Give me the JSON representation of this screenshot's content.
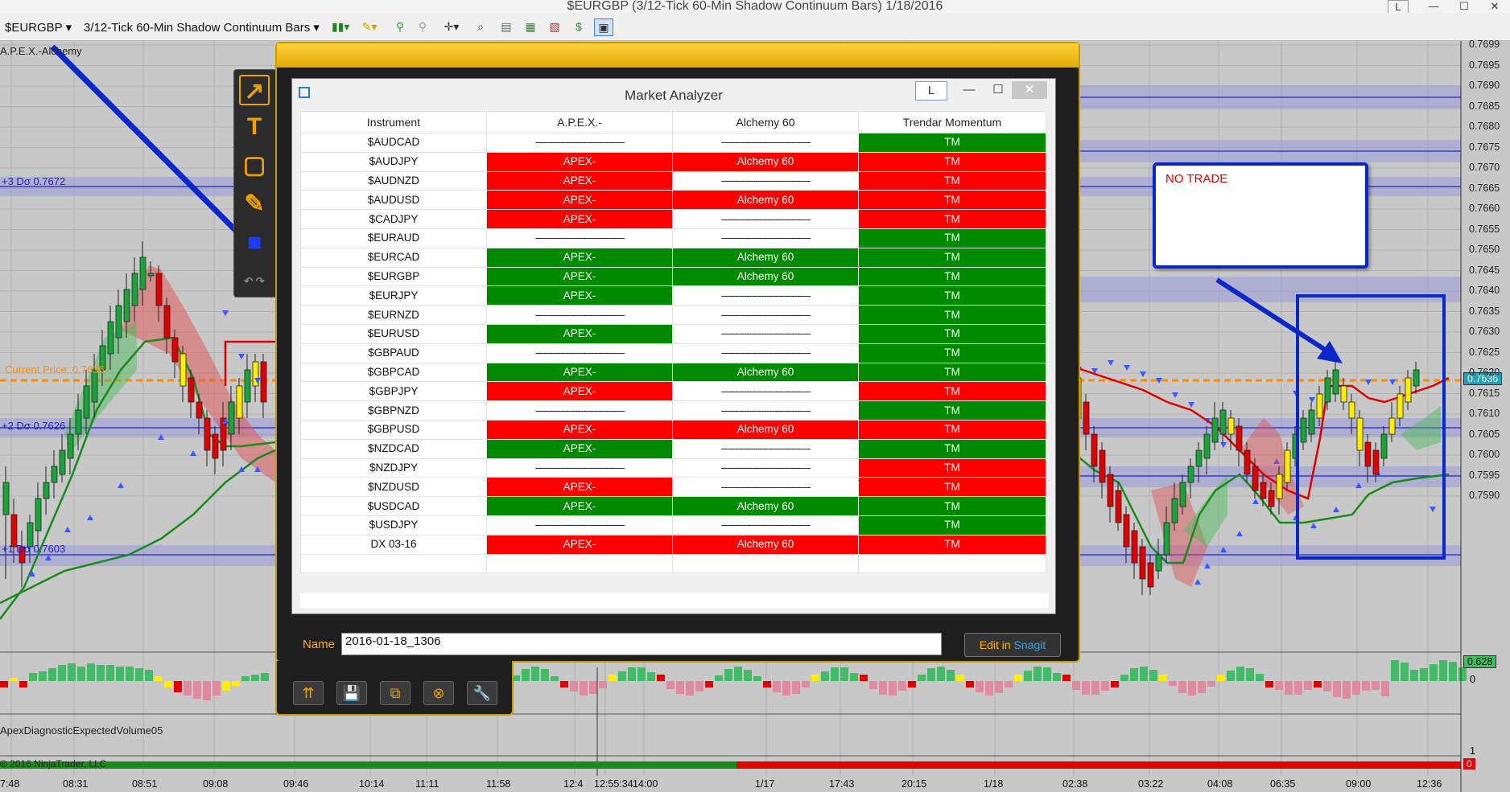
{
  "window_title": "$EURGBP (3/12-Tick 60-Min Shadow Continuum Bars)  1/18/2016",
  "window_controls": {
    "left_btn": "L",
    "minimize": "—",
    "maximize": "☐",
    "close": "✕"
  },
  "toolbar": {
    "instrument": "$EURGBP",
    "bars": "3/12-Tick 60-Min Shadow Continuum Bars"
  },
  "chart": {
    "indicator_label": "A.P.E.X.-Alchemy",
    "plus3_label": "+3 Dσ 0.7672",
    "plus2_label": "+2 Dσ 0.7626",
    "plus1_label": "+1 Dσ 0.7603",
    "current_price_label": "Current Price: 0.7636",
    "current_price_box": "0.7636",
    "volume_label": "ApexDiagnosticExpectedVolume05",
    "copyright": "© 2016 NinjaTrader, LLC",
    "osc_value": "0.628",
    "osc_zero": "0",
    "vol_zero": "0",
    "vol_one": "1",
    "price_axis": [
      "0.7699",
      "0.7695",
      "0.7690",
      "0.7685",
      "0.7680",
      "0.7675",
      "0.7670",
      "0.7665",
      "0.7660",
      "0.7655",
      "0.7650",
      "0.7645",
      "0.7640",
      "0.7635",
      "0.7630",
      "0.7625",
      "0.7620",
      "0.7615",
      "0.7610",
      "0.7605",
      "0.7600",
      "0.7595",
      "0.7590"
    ],
    "time_axis": [
      "7:48",
      "08:31",
      "08:51",
      "09:08",
      "09:46",
      "10:14",
      "11:11",
      "11:58",
      "12:4",
      "12:55:34",
      "14:00",
      "1/17",
      "17:43",
      "20:15",
      "1/18",
      "02:38",
      "03:22",
      "04:08",
      "06:35",
      "09:00",
      "12:36"
    ],
    "colors": {
      "bull": "#1aa33a",
      "bear": "#e00000",
      "neutral": "#ffee00",
      "band": "#3030d0",
      "annot": "#0a28c8",
      "current_price": "#ff8c00"
    }
  },
  "no_trade_label": "NO TRADE",
  "market_analyzer": {
    "title": "Market Analyzer",
    "controls": {
      "left": "L",
      "min": "—",
      "max": "☐",
      "close": "✕"
    },
    "columns": [
      "Instrument",
      "A.P.E.X.-",
      "Alchemy 60",
      "Trendar Momentum"
    ],
    "blank": "----------------------------—",
    "rows": [
      {
        "instrument": "$AUDCAD",
        "apex": "",
        "alchemy": "",
        "tm": "TM",
        "tm_color": "green"
      },
      {
        "instrument": "$AUDJPY",
        "apex": "APEX-",
        "apex_color": "red",
        "alchemy": "Alchemy 60",
        "alchemy_color": "red",
        "tm": "TM",
        "tm_color": "red"
      },
      {
        "instrument": "$AUDNZD",
        "apex": "APEX-",
        "apex_color": "red",
        "alchemy": "",
        "tm": "TM",
        "tm_color": "red"
      },
      {
        "instrument": "$AUDUSD",
        "apex": "APEX-",
        "apex_color": "red",
        "alchemy": "Alchemy 60",
        "alchemy_color": "red",
        "tm": "TM",
        "tm_color": "red"
      },
      {
        "instrument": "$CADJPY",
        "apex": "APEX-",
        "apex_color": "red",
        "alchemy": "",
        "tm": "TM",
        "tm_color": "red"
      },
      {
        "instrument": "$EURAUD",
        "apex": "",
        "alchemy": "",
        "tm": "TM",
        "tm_color": "green"
      },
      {
        "instrument": "$EURCAD",
        "apex": "APEX-",
        "apex_color": "green",
        "alchemy": "Alchemy 60",
        "alchemy_color": "green",
        "tm": "TM",
        "tm_color": "green"
      },
      {
        "instrument": "$EURGBP",
        "apex": "APEX-",
        "apex_color": "green",
        "alchemy": "Alchemy 60",
        "alchemy_color": "green",
        "tm": "TM",
        "tm_color": "green"
      },
      {
        "instrument": "$EURJPY",
        "apex": "APEX-",
        "apex_color": "green",
        "alchemy": "",
        "tm": "TM",
        "tm_color": "green"
      },
      {
        "instrument": "$EURNZD",
        "apex": "",
        "alchemy": "",
        "tm": "TM",
        "tm_color": "green"
      },
      {
        "instrument": "$EURUSD",
        "apex": "APEX-",
        "apex_color": "green",
        "alchemy": "",
        "tm": "TM",
        "tm_color": "green"
      },
      {
        "instrument": "$GBPAUD",
        "apex": "",
        "alchemy": "",
        "tm": "TM",
        "tm_color": "green"
      },
      {
        "instrument": "$GBPCAD",
        "apex": "APEX-",
        "apex_color": "green",
        "alchemy": "Alchemy 60",
        "alchemy_color": "green",
        "tm": "TM",
        "tm_color": "green"
      },
      {
        "instrument": "$GBPJPY",
        "apex": "APEX-",
        "apex_color": "red",
        "alchemy": "",
        "tm": "TM",
        "tm_color": "red"
      },
      {
        "instrument": "$GBPNZD",
        "apex": "",
        "alchemy": "",
        "tm": "TM",
        "tm_color": "green"
      },
      {
        "instrument": "$GBPUSD",
        "apex": "APEX-",
        "apex_color": "red",
        "alchemy": "Alchemy 60",
        "alchemy_color": "red",
        "tm": "TM",
        "tm_color": "red"
      },
      {
        "instrument": "$NZDCAD",
        "apex": "APEX-",
        "apex_color": "green",
        "alchemy": "",
        "tm": "TM",
        "tm_color": "green"
      },
      {
        "instrument": "$NZDJPY",
        "apex": "",
        "alchemy": "",
        "tm": "TM",
        "tm_color": "red"
      },
      {
        "instrument": "$NZDUSD",
        "apex": "APEX-",
        "apex_color": "red",
        "alchemy": "",
        "tm": "TM",
        "tm_color": "red"
      },
      {
        "instrument": "$USDCAD",
        "apex": "APEX-",
        "apex_color": "green",
        "alchemy": "Alchemy 60",
        "alchemy_color": "green",
        "tm": "TM",
        "tm_color": "green"
      },
      {
        "instrument": "$USDJPY",
        "apex": "",
        "alchemy": "",
        "tm": "TM",
        "tm_color": "green"
      },
      {
        "instrument": "DX 03-16",
        "apex": "APEX-",
        "apex_color": "red",
        "alchemy": "Alchemy 60",
        "alchemy_color": "red",
        "tm": "TM",
        "tm_color": "red"
      }
    ]
  },
  "snagit": {
    "name_label": "Name",
    "name_value": "2016-01-18_1306",
    "edit_prefix": "Edit in ",
    "edit_brand": "Snagit",
    "tools": [
      "arrow-tool-icon",
      "text-tool-icon",
      "shape-tool-icon",
      "highlighter-tool-icon",
      "color-swatch-icon"
    ],
    "bottom_buttons": [
      "share-icon",
      "save-icon",
      "copy-icon",
      "delete-icon",
      "tools-icon"
    ]
  }
}
